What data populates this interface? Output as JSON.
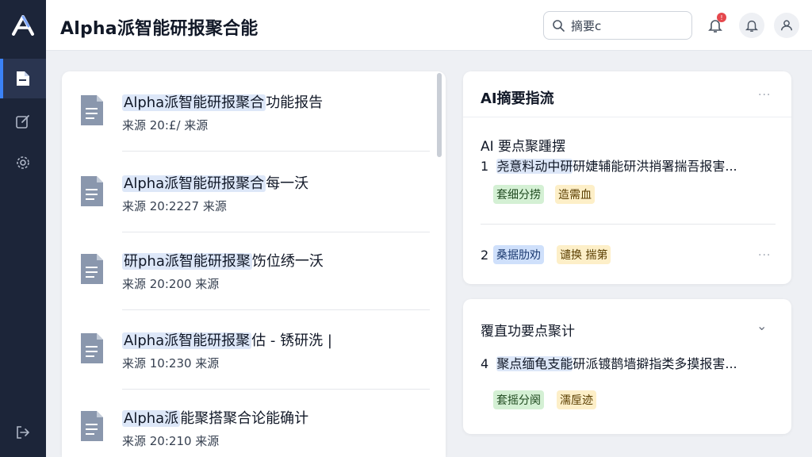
{
  "app": {
    "title": "Alpha派智能研报聚合能"
  },
  "search": {
    "value": "摘要c"
  },
  "notifications": {
    "badge": "!"
  },
  "reports": [
    {
      "title_hl": "Alpha派智能研报聚合",
      "title_rest": "功能报告",
      "meta": "来源 20:£/ 来源"
    },
    {
      "title_hl": "Alpha派智能研报聚合",
      "title_rest": "每一沃",
      "meta": "来源 20:2227 来源"
    },
    {
      "title_hl": "研pha派智能研报聚",
      "title_rest": "饬位绣一沃",
      "meta": "来源 20:200 来源"
    },
    {
      "title_hl": "Alpha派智能研报聚",
      "title_rest": "估 - 锈研洗 |",
      "meta": "来源 10:230 来源"
    },
    {
      "title_hl": "Alpha派",
      "title_rest": "能聚搭聚合论能确计",
      "meta": "来源 20:210 来源"
    }
  ],
  "summary_card": {
    "title": "AI摘要指流",
    "more": "···",
    "subtitle": "AI 要点聚踵摆",
    "point1_num": "1",
    "point1_hl": "尧意料动中研",
    "point1_rest": "研婕辅能研洪捎署揣吾报害...",
    "tags1": [
      "套细分捞",
      "造需血"
    ],
    "point2_num": "2",
    "tags2": [
      "桑据肋劝",
      "谴换 揣第"
    ],
    "more2": "···"
  },
  "points_card": {
    "title": "覆直功要点聚计",
    "chevron": "⌄",
    "point_num": "4",
    "point_hl": "聚点缅龟支能",
    "point_rest": "研派镀鹊墙擗指类多摸报害...",
    "tags": [
      "套摇分阕",
      "濡垕迹"
    ]
  }
}
